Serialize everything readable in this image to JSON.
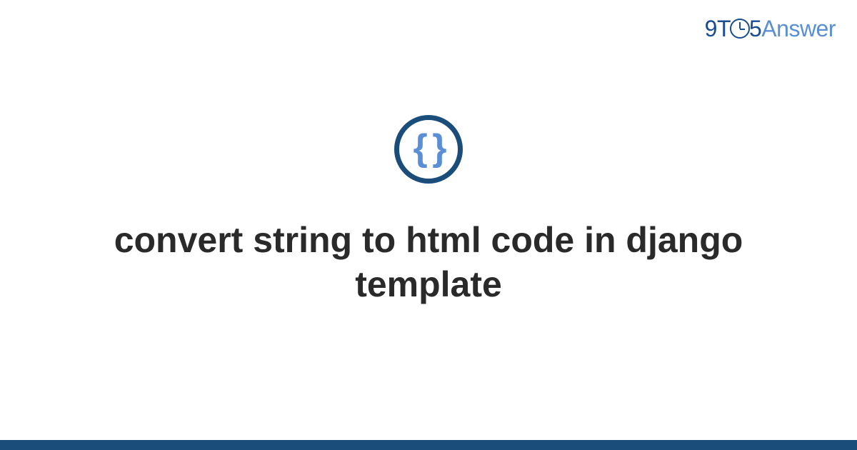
{
  "logo": {
    "prefix": "9T",
    "suffix": "5",
    "word": "Answer"
  },
  "icon": {
    "braces": "{ }"
  },
  "title": "convert string to html code in django template"
}
